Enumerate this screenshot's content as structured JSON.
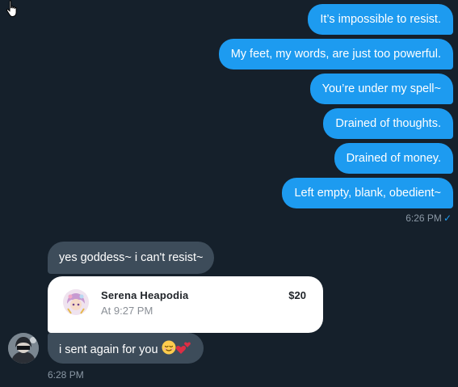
{
  "sent_messages": [
    {
      "text": "It’s impossible to resist."
    },
    {
      "text": "My feet, my words, are just too powerful."
    },
    {
      "text": "You’re under my spell~"
    },
    {
      "text": "Drained of thoughts."
    },
    {
      "text": "Drained of money."
    },
    {
      "text": "Left empty, blank, obedient~"
    }
  ],
  "sent_timestamp": "6:26 PM",
  "sent_status_icon": "check-icon",
  "received": {
    "message_1": "yes goddess~ i can't resist~",
    "payment": {
      "name": "Serena Heapodia",
      "time": "At 9:27 PM",
      "amount": "$20"
    },
    "message_2": "i sent again for you",
    "message_2_emojis": [
      "relieved-face-emoji",
      "two-hearts-emoji"
    ],
    "timestamp": "6:28 PM"
  },
  "colors": {
    "background": "#15202b",
    "sent_bubble": "#1d9bf0",
    "received_bubble": "#3d4c5a",
    "timestamp": "#8b98a5"
  }
}
